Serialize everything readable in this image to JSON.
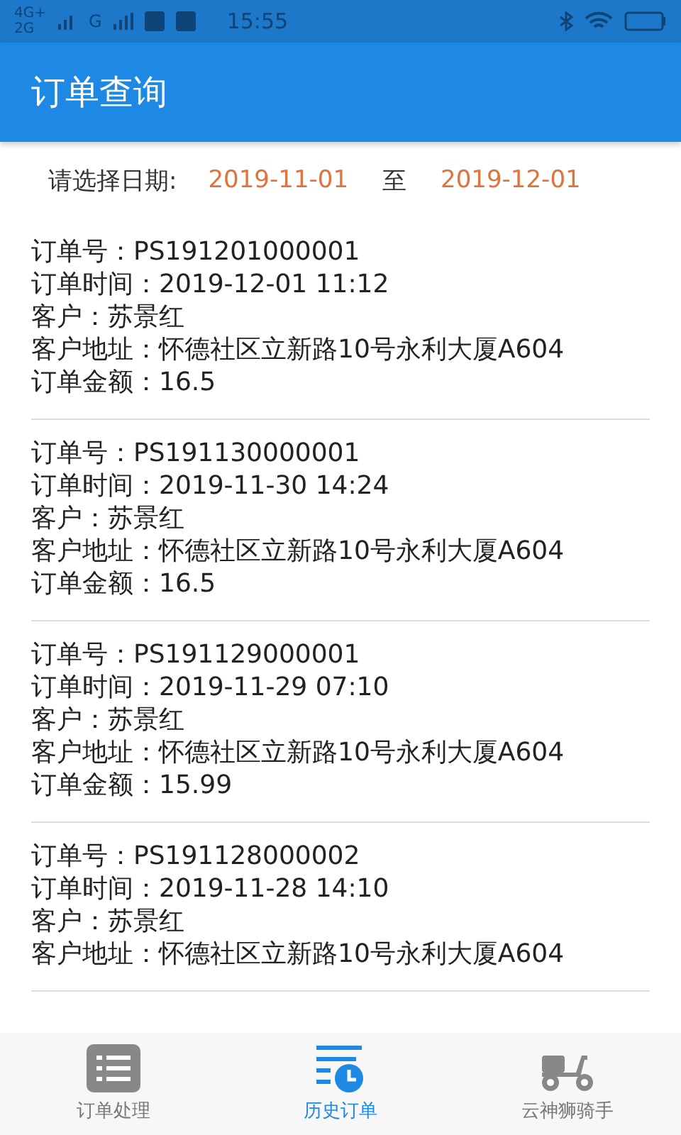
{
  "status_bar": {
    "network_1": "4G+",
    "network_2": "2G",
    "network_3": "G",
    "time": "15:55"
  },
  "header": {
    "title": "订单查询"
  },
  "date_filter": {
    "label": "请选择日期:",
    "start": "2019-11-01",
    "separator": "至",
    "end": "2019-12-01"
  },
  "orders": [
    {
      "lines": [
        "订单号：PS191201000001",
        "订单时间：2019-12-01 11:12",
        "客户：苏景红",
        "客户地址：怀德社区立新路10号永利大厦A604",
        "订单金额：16.5"
      ]
    },
    {
      "lines": [
        "订单号：PS191130000001",
        "订单时间：2019-11-30 14:24",
        "客户：苏景红",
        "客户地址：怀德社区立新路10号永利大厦A604",
        "订单金额：16.5"
      ]
    },
    {
      "lines": [
        "订单号：PS191129000001",
        "订单时间：2019-11-29 07:10",
        "客户：苏景红",
        "客户地址：怀德社区立新路10号永利大厦A604",
        "订单金额：15.99"
      ]
    },
    {
      "lines": [
        "订单号：PS191128000002",
        "订单时间：2019-11-28 14:10",
        "客户：苏景红",
        "客户地址：怀德社区立新路10号永利大厦A604"
      ]
    }
  ],
  "tabs": [
    {
      "label": "订单处理",
      "kind": "list",
      "selected": false
    },
    {
      "label": "历史订单",
      "kind": "history",
      "selected": true
    },
    {
      "label": "云神狮骑手",
      "kind": "scooter",
      "selected": false
    }
  ]
}
